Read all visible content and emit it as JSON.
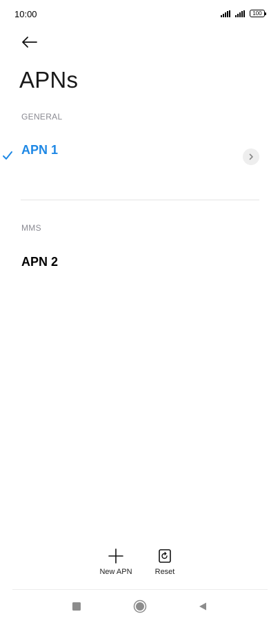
{
  "status_bar": {
    "time": "10:00",
    "battery": "100"
  },
  "header": {
    "title": "APNs",
    "back_icon": "arrow-left-icon"
  },
  "sections": {
    "general": {
      "header": "GENERAL",
      "apn": {
        "name": "APN 1",
        "selected": true,
        "selected_color": "#1e88e5"
      }
    },
    "mms": {
      "header": "MMS",
      "apn": {
        "name": "APN 2",
        "selected": false
      }
    }
  },
  "actions": {
    "new_apn": {
      "label": "New APN",
      "icon": "plus-icon"
    },
    "reset": {
      "label": "Reset",
      "icon": "reset-icon"
    }
  },
  "nav_bar": {
    "recents": "square-icon",
    "home": "circle-icon",
    "back": "triangle-back-icon"
  }
}
